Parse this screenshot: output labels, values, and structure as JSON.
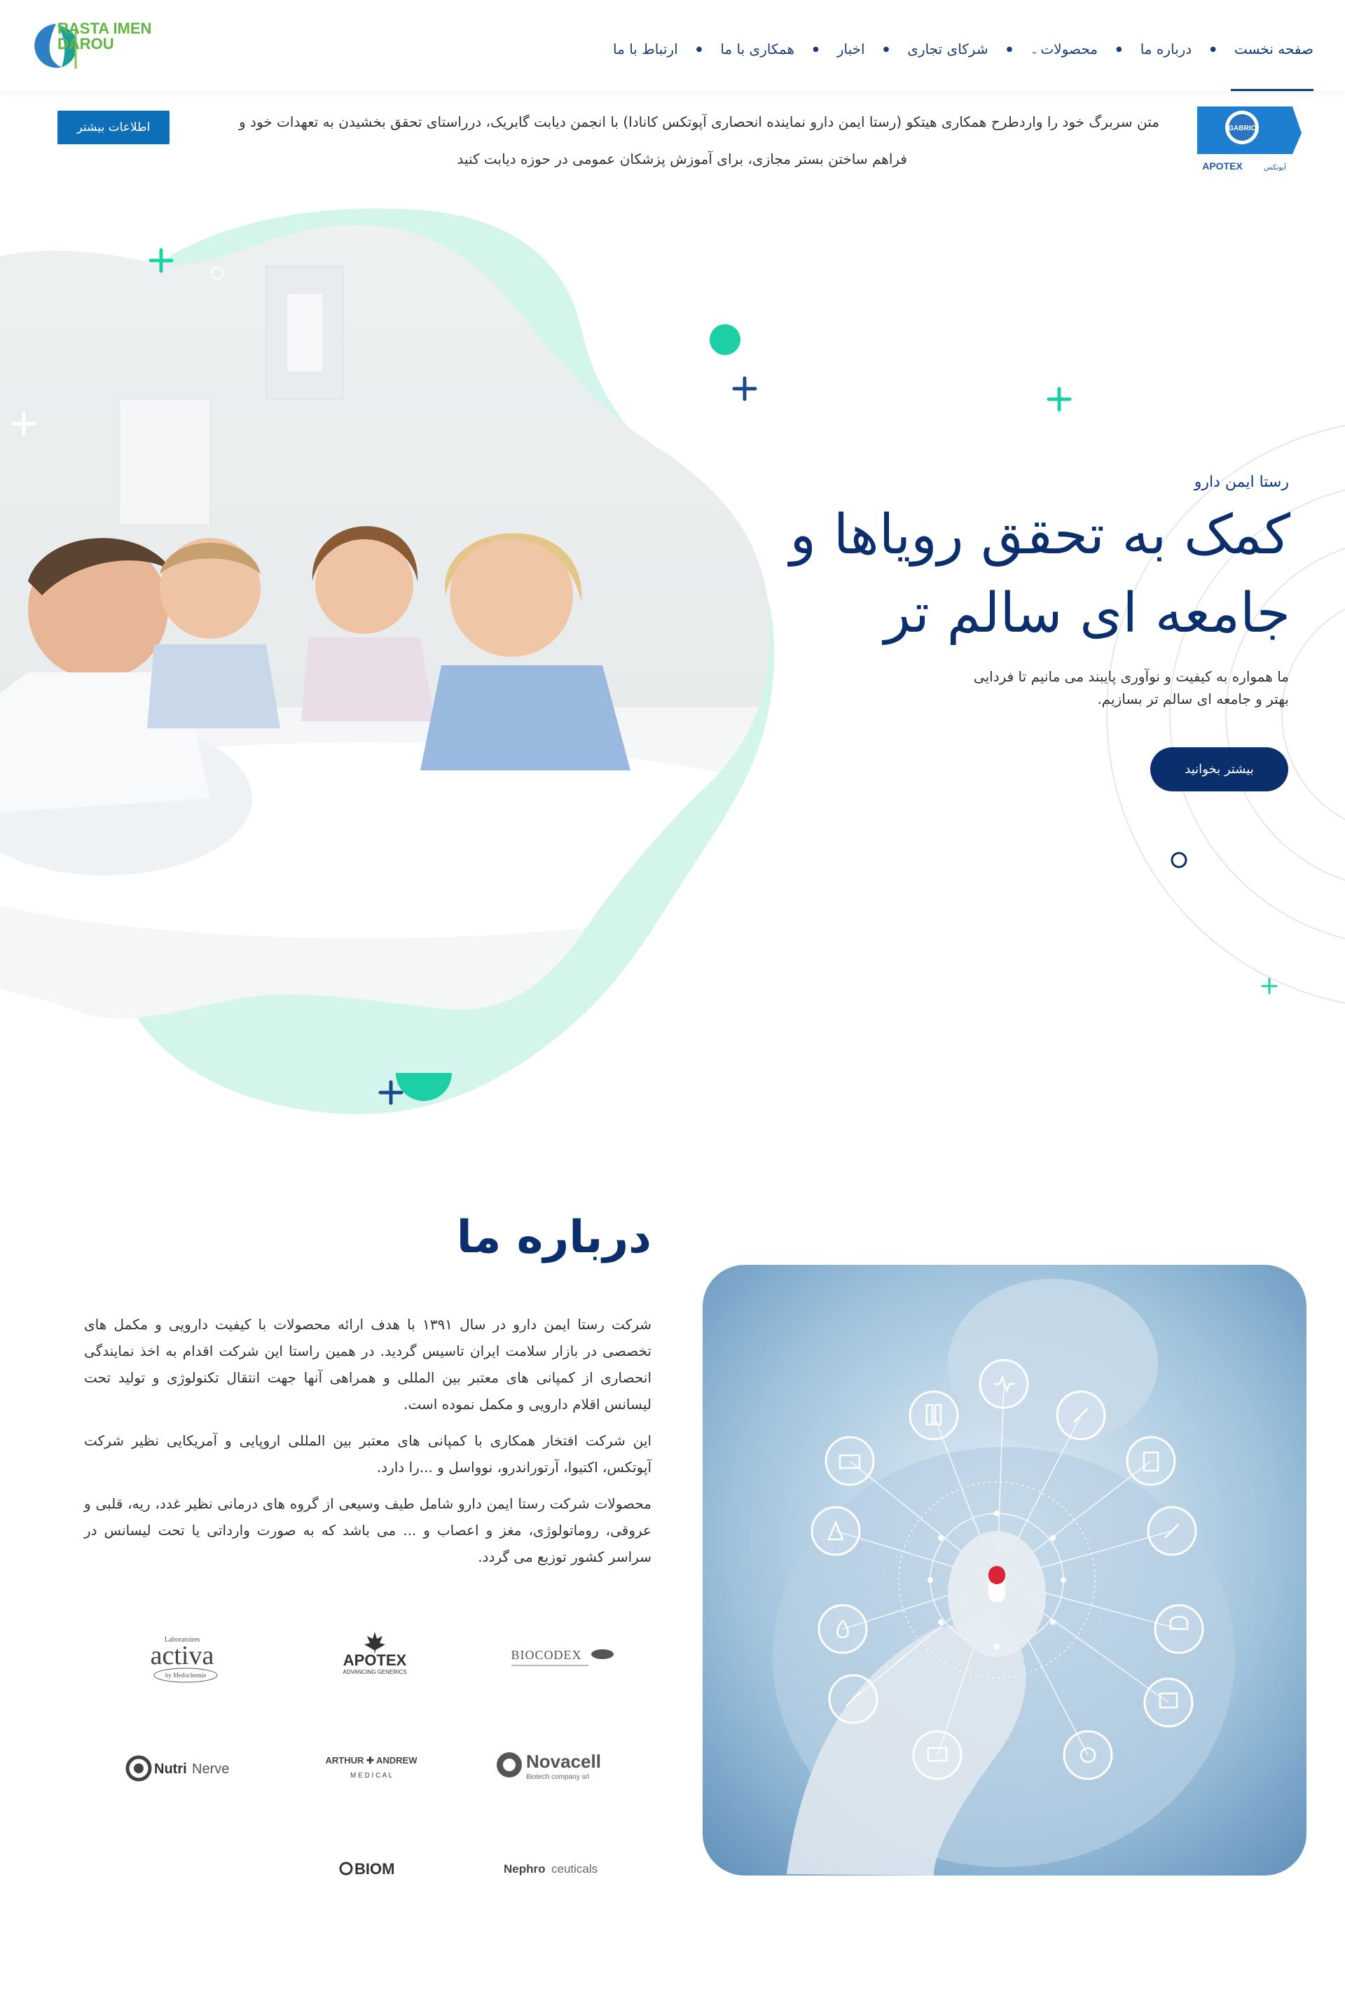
{
  "header": {
    "logo_text_line1": "RASTA IMEN",
    "logo_text_line2": "DAROU",
    "nav": [
      {
        "label": "صفحه نخست",
        "active": true
      },
      {
        "label": "درباره ما"
      },
      {
        "label": "محصولات",
        "has_dropdown": true
      },
      {
        "label": "شرکای تجاری"
      },
      {
        "label": "اخبار"
      },
      {
        "label": "همکاری با ما"
      },
      {
        "label": "ارتباط با ما"
      }
    ]
  },
  "announcement": {
    "line1": "متن سربرگ خود را واردطرح همکاری هیتکو (رستا ایمن دارو نماینده انحصاری آپوتکس کانادا) با انجمن دیابت گابریک، درراستای تحقق بخشیدن به تعهدات خود و",
    "line2": "فراهم ساختن بستر مجازی، برای آموزش پزشکان عمومی در حوزه دیابت کنید",
    "button_label": "اطلاعات بیشتر",
    "badge_top": "GABRIC",
    "badge_brand": "APOTEX",
    "badge_brand_fa": "آپوتکس"
  },
  "hero": {
    "subtitle": "رستا ایمن دارو",
    "title_line1": "کمک به تحقق رویاها و",
    "title_line2": "جامعه ای سالم تر",
    "description": "ما همواره به کیفیت و نوآوری پایبند می مانیم تا فردایی بهتر و جامعه ای سالم تر بسازیم.",
    "button_label": "بیشتر بخوانید"
  },
  "about": {
    "title": "درباره ما",
    "paragraphs": [
      "شرکت رستا ایمن دارو در سال ۱۳۹۱ با هدف ارائه محصولات با کیفیت دارویی و مکمل های تخصصی در بازار سلامت ایران تاسیس گردید. در همین راستا این شرکت اقدام به اخذ نمایندگی انحصاری از کمپانی های معتبر بین المللی و همراهی آنها جهت انتقال تکنولوژی و تولید تحت لیسانس اقلام دارویی و مکمل نموده است.",
      "این شرکت افتخار همکاری با کمپانی های معتبر بین المللی اروپایی و آمریکایی نظیر شرکت آپوتکس، اکتیوا، آرتوراندرو، نوواسل و ...را دارد.",
      "محصولات شرکت رستا ایمن دارو شامل طیف وسیعی از گروه های درمانی نظیر غدد، ریه، قلبی و عروقی، روماتولوژی، مغز و اعصاب و ... می باشد که به صورت وارداتی یا تحت لیسانس در سراسر کشور توزیع می گردد."
    ]
  },
  "partners": {
    "activa": "activa",
    "activa_small": "Laboratoires",
    "activa_sub": "by Medochemie",
    "apotex": "APOTEX",
    "apotex_sub": "ADVANCING GENERICS",
    "biocodex": "BIOCODEX",
    "nutri_a": "Nutri",
    "nutri_b": "Nerve",
    "arthur": "ARTHUR ✚ ANDREW",
    "arthur_sub": "M E D I C A L",
    "novacell": "Novacell",
    "novacell_sub": "Biotech company srl",
    "biom": "BIOM",
    "nephro_a": "Nephro",
    "nephro_b": "ceuticals"
  },
  "colors": {
    "primary": "#0b2f6c",
    "accent_mint": "#d3f5ec",
    "accent_teal": "#1ccfa5",
    "button_blue": "#0d6fb8",
    "logo_green": "#62b544"
  }
}
